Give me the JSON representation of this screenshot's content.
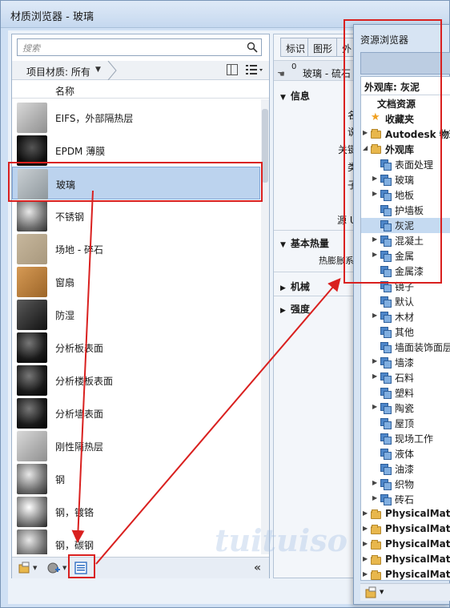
{
  "window": {
    "title": "材质浏览器 - 玻璃"
  },
  "left_panel": {
    "search_placeholder": "搜索",
    "filter_label": "项目材质: 所有",
    "column_header": "名称",
    "materials": [
      {
        "label": "EIFS，外部隔热层",
        "thumb": "gray-box"
      },
      {
        "label": "EPDM 薄膜",
        "thumb": "black-cylinder"
      },
      {
        "label": "玻璃",
        "thumb": "glass-box",
        "selected": true
      },
      {
        "label": "不锈钢",
        "thumb": "steel-sphere"
      },
      {
        "label": "场地 - 碎石",
        "thumb": "gravel"
      },
      {
        "label": "窗扇",
        "thumb": "wood-box"
      },
      {
        "label": "防湿",
        "thumb": "dark-box"
      },
      {
        "label": "分析板表面",
        "thumb": "dark-sphere"
      },
      {
        "label": "分析楼板表面",
        "thumb": "dark-sphere"
      },
      {
        "label": "分析墙表面",
        "thumb": "dark-sphere"
      },
      {
        "label": "刚性隔热层",
        "thumb": "gray-box"
      },
      {
        "label": "钢",
        "thumb": "steel-sphere"
      },
      {
        "label": "钢，镀铬",
        "thumb": "chrome-sphere"
      },
      {
        "label": "钢，碳钢",
        "thumb": "steel-sphere"
      }
    ]
  },
  "editor_panel": {
    "tabs": [
      "标识",
      "图形",
      "外"
    ],
    "material_number": "0",
    "material_name": "玻璃 - 硫石",
    "sections": {
      "info": "信息",
      "basic_thermal": "基本热量",
      "mechanical": "机械",
      "strength": "强度"
    },
    "field_fragments": [
      "名",
      "说",
      "关键",
      "类",
      "子",
      "源 U",
      "热膨胀系"
    ]
  },
  "asset_browser": {
    "title": "资源浏览器",
    "header": "外观库: 灰泥",
    "tree": [
      {
        "label": "文档资源",
        "bold": true,
        "icon": "none",
        "expander": ""
      },
      {
        "label": "收藏夹",
        "bold": true,
        "icon": "star-icon",
        "expander": ""
      },
      {
        "label": "Autodesk 物理",
        "bold": true,
        "icon": "folder-icon",
        "expander": "▶"
      },
      {
        "label": "外观库",
        "bold": true,
        "icon": "folder-icon",
        "expander": "◢"
      },
      {
        "label": "表面处理",
        "icon": "category-icon",
        "expander": ""
      },
      {
        "label": "玻璃",
        "icon": "category-icon",
        "expander": "▶"
      },
      {
        "label": "地板",
        "icon": "category-icon",
        "expander": "▶"
      },
      {
        "label": "护墙板",
        "icon": "category-icon",
        "expander": ""
      },
      {
        "label": "灰泥",
        "icon": "category-icon",
        "expander": "",
        "selected": true
      },
      {
        "label": "混凝土",
        "icon": "category-icon",
        "expander": "▶"
      },
      {
        "label": "金属",
        "icon": "category-icon",
        "expander": "▶"
      },
      {
        "label": "金属漆",
        "icon": "category-icon",
        "expander": ""
      },
      {
        "label": "镜子",
        "icon": "category-icon",
        "expander": ""
      },
      {
        "label": "默认",
        "icon": "category-icon",
        "expander": ""
      },
      {
        "label": "木材",
        "icon": "category-icon",
        "expander": "▶"
      },
      {
        "label": "其他",
        "icon": "category-icon",
        "expander": ""
      },
      {
        "label": "墙面装饰面层",
        "icon": "category-icon",
        "expander": ""
      },
      {
        "label": "墙漆",
        "icon": "category-icon",
        "expander": "▶"
      },
      {
        "label": "石料",
        "icon": "category-icon",
        "expander": "▶"
      },
      {
        "label": "塑料",
        "icon": "category-icon",
        "expander": ""
      },
      {
        "label": "陶瓷",
        "icon": "category-icon",
        "expander": "▶"
      },
      {
        "label": "屋顶",
        "icon": "category-icon",
        "expander": ""
      },
      {
        "label": "现场工作",
        "icon": "category-icon",
        "expander": ""
      },
      {
        "label": "液体",
        "icon": "category-icon",
        "expander": ""
      },
      {
        "label": "油漆",
        "icon": "category-icon",
        "expander": ""
      },
      {
        "label": "织物",
        "icon": "category-icon",
        "expander": "▶"
      },
      {
        "label": "砖石",
        "icon": "category-icon",
        "expander": "▶"
      },
      {
        "label": "PhysicalMater",
        "bold": true,
        "icon": "folder-icon",
        "expander": "▶"
      },
      {
        "label": "PhysicalMater",
        "bold": true,
        "icon": "folder-icon",
        "expander": "▶"
      },
      {
        "label": "PhysicalMater",
        "bold": true,
        "icon": "folder-icon",
        "expander": "▶"
      },
      {
        "label": "PhysicalMater",
        "bold": true,
        "icon": "folder-icon",
        "expander": "▶"
      },
      {
        "label": "PhysicalMater",
        "bold": true,
        "icon": "folder-icon",
        "expander": "▶"
      }
    ]
  },
  "watermark": "tuituiso",
  "colors": {
    "highlight_red": "#d9201f",
    "selection_blue": "#bcd3ee"
  }
}
